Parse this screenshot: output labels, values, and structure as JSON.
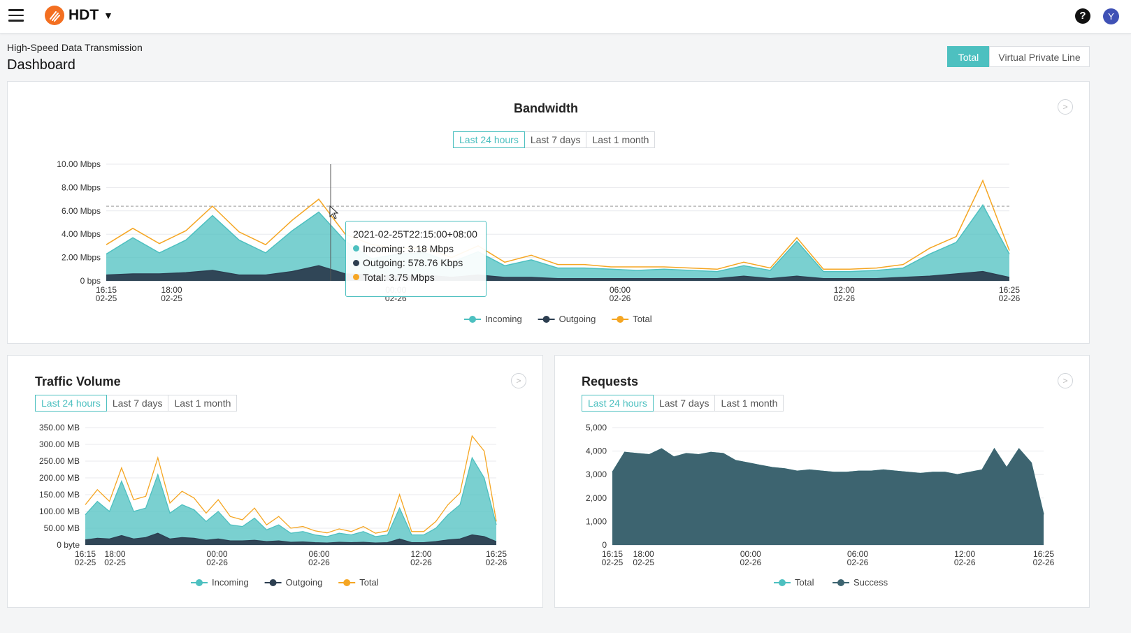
{
  "app": {
    "name": "HDT",
    "help_icon": "?",
    "user_initial": "Y"
  },
  "page": {
    "subtitle": "High-Speed Data Transmission",
    "title": "Dashboard"
  },
  "view_switch": {
    "options": [
      "Total",
      "Virtual Private Line"
    ],
    "selected": "Total"
  },
  "colors": {
    "accent": "#4dc0c0",
    "incoming": "#4dc0c0",
    "outgoing": "#2c3e50",
    "total": "#f5a623",
    "requests_fill": "#3d6470",
    "logo": "#f36f21"
  },
  "time_ranges": [
    "Last 24 hours",
    "Last 7 days",
    "Last 1 month"
  ],
  "bandwidth": {
    "title": "Bandwidth",
    "tooltip": {
      "time": "2021-02-25T22:15:00+08:00",
      "incoming": "Incoming: 3.18 Mbps",
      "outgoing": "Outgoing: 578.76 Kbps",
      "total": "Total: 3.75 Mbps"
    }
  },
  "traffic": {
    "title": "Traffic Volume"
  },
  "requests": {
    "title": "Requests"
  },
  "chart_data": [
    {
      "type": "area",
      "title": "Bandwidth",
      "y_ticks": [
        "0 bps",
        "2.00 Mbps",
        "4.00 Mbps",
        "6.00 Mbps",
        "8.00 Mbps",
        "10.00 Mbps"
      ],
      "ylim": [
        0,
        10
      ],
      "unit": "Mbps",
      "x_ticks": [
        [
          "16:15",
          "02-25"
        ],
        [
          "18:00",
          "02-25"
        ],
        [
          "00:00",
          "02-26"
        ],
        [
          "06:00",
          "02-26"
        ],
        [
          "12:00",
          "02-26"
        ],
        [
          "16:25",
          "02-26"
        ]
      ],
      "x_hours": [
        0,
        1.75,
        7.75,
        13.75,
        19.75,
        24.17
      ],
      "reference_line": 6.4,
      "legend": [
        "Incoming",
        "Outgoing",
        "Total"
      ],
      "series": [
        {
          "name": "Incoming",
          "values": [
            2.3,
            3.7,
            2.4,
            3.5,
            5.6,
            3.5,
            2.4,
            4.3,
            5.9,
            3.4,
            1.9,
            2.3,
            2.4,
            1.6,
            2.5,
            1.3,
            1.8,
            1.1,
            1.1,
            1.0,
            0.9,
            1.0,
            0.9,
            0.8,
            1.3,
            0.9,
            3.4,
            0.8,
            0.8,
            0.9,
            1.1,
            2.3,
            3.3,
            6.5,
            2.3
          ]
        },
        {
          "name": "Outgoing",
          "values": [
            0.5,
            0.6,
            0.6,
            0.7,
            0.9,
            0.5,
            0.5,
            0.8,
            1.3,
            0.6,
            0.5,
            0.4,
            0.5,
            0.3,
            0.5,
            0.3,
            0.3,
            0.2,
            0.2,
            0.2,
            0.2,
            0.2,
            0.2,
            0.2,
            0.4,
            0.2,
            0.4,
            0.2,
            0.2,
            0.2,
            0.3,
            0.4,
            0.6,
            0.8,
            0.3
          ]
        },
        {
          "name": "Total",
          "values": [
            3.1,
            4.5,
            3.2,
            4.3,
            6.4,
            4.2,
            3.1,
            5.2,
            7.0,
            4.0,
            3.1,
            2.8,
            2.8,
            2.0,
            3.0,
            1.6,
            2.2,
            1.4,
            1.4,
            1.2,
            1.2,
            1.2,
            1.1,
            1.0,
            1.6,
            1.1,
            3.7,
            1.0,
            1.0,
            1.1,
            1.4,
            2.8,
            3.8,
            8.6,
            2.6
          ]
        }
      ]
    },
    {
      "type": "area",
      "title": "Traffic Volume",
      "y_ticks": [
        "0 byte",
        "50.00 MB",
        "100.00 MB",
        "150.00 MB",
        "200.00 MB",
        "250.00 MB",
        "300.00 MB",
        "350.00 MB"
      ],
      "ylim": [
        0,
        350
      ],
      "unit": "MB",
      "x_ticks": [
        [
          "16:15",
          "02-25"
        ],
        [
          "18:00",
          "02-25"
        ],
        [
          "00:00",
          "02-26"
        ],
        [
          "06:00",
          "02-26"
        ],
        [
          "12:00",
          "02-26"
        ],
        [
          "16:25",
          "02-26"
        ]
      ],
      "x_hours": [
        0,
        1.75,
        7.75,
        13.75,
        19.75,
        24.17
      ],
      "legend": [
        "Incoming",
        "Outgoing",
        "Total"
      ],
      "series": [
        {
          "name": "Incoming",
          "values": [
            90,
            130,
            100,
            190,
            100,
            110,
            210,
            95,
            120,
            105,
            70,
            100,
            60,
            55,
            80,
            45,
            60,
            35,
            40,
            30,
            25,
            35,
            30,
            40,
            25,
            30,
            110,
            30,
            30,
            50,
            90,
            120,
            260,
            200,
            60
          ]
        },
        {
          "name": "Outgoing",
          "values": [
            15,
            20,
            18,
            28,
            18,
            22,
            35,
            18,
            22,
            20,
            14,
            18,
            12,
            12,
            14,
            10,
            12,
            8,
            9,
            7,
            6,
            8,
            7,
            8,
            6,
            7,
            18,
            7,
            7,
            10,
            15,
            18,
            30,
            25,
            10
          ]
        },
        {
          "name": "Total",
          "values": [
            120,
            165,
            130,
            230,
            135,
            145,
            260,
            125,
            160,
            140,
            95,
            135,
            85,
            75,
            110,
            60,
            85,
            50,
            55,
            42,
            36,
            48,
            40,
            55,
            35,
            42,
            150,
            40,
            40,
            70,
            120,
            155,
            325,
            280,
            70
          ]
        }
      ]
    },
    {
      "type": "area",
      "title": "Requests",
      "y_ticks": [
        "0",
        "1,000",
        "2,000",
        "3,000",
        "4,000",
        "5,000"
      ],
      "ylim": [
        0,
        5000
      ],
      "x_ticks": [
        [
          "16:15",
          "02-25"
        ],
        [
          "18:00",
          "02-25"
        ],
        [
          "00:00",
          "02-26"
        ],
        [
          "06:00",
          "02-26"
        ],
        [
          "12:00",
          "02-26"
        ],
        [
          "16:25",
          "02-26"
        ]
      ],
      "x_hours": [
        0,
        1.75,
        7.75,
        13.75,
        19.75,
        24.17
      ],
      "legend": [
        "Total",
        "Success"
      ],
      "series": [
        {
          "name": "Total",
          "values": [
            3100,
            3950,
            3900,
            3850,
            4100,
            3750,
            3900,
            3850,
            3950,
            3900,
            3600,
            3500,
            3400,
            3300,
            3250,
            3150,
            3200,
            3150,
            3100,
            3100,
            3150,
            3150,
            3200,
            3150,
            3100,
            3050,
            3100,
            3100,
            3000,
            3100,
            3200,
            4100,
            3300,
            4100,
            3500,
            1300
          ]
        },
        {
          "name": "Success",
          "values": [
            3100,
            3950,
            3900,
            3850,
            4100,
            3750,
            3900,
            3850,
            3950,
            3900,
            3600,
            3500,
            3400,
            3300,
            3250,
            3150,
            3200,
            3150,
            3100,
            3100,
            3150,
            3150,
            3200,
            3150,
            3100,
            3050,
            3100,
            3100,
            3000,
            3100,
            3200,
            4100,
            3300,
            4100,
            3500,
            1300
          ]
        }
      ]
    }
  ]
}
